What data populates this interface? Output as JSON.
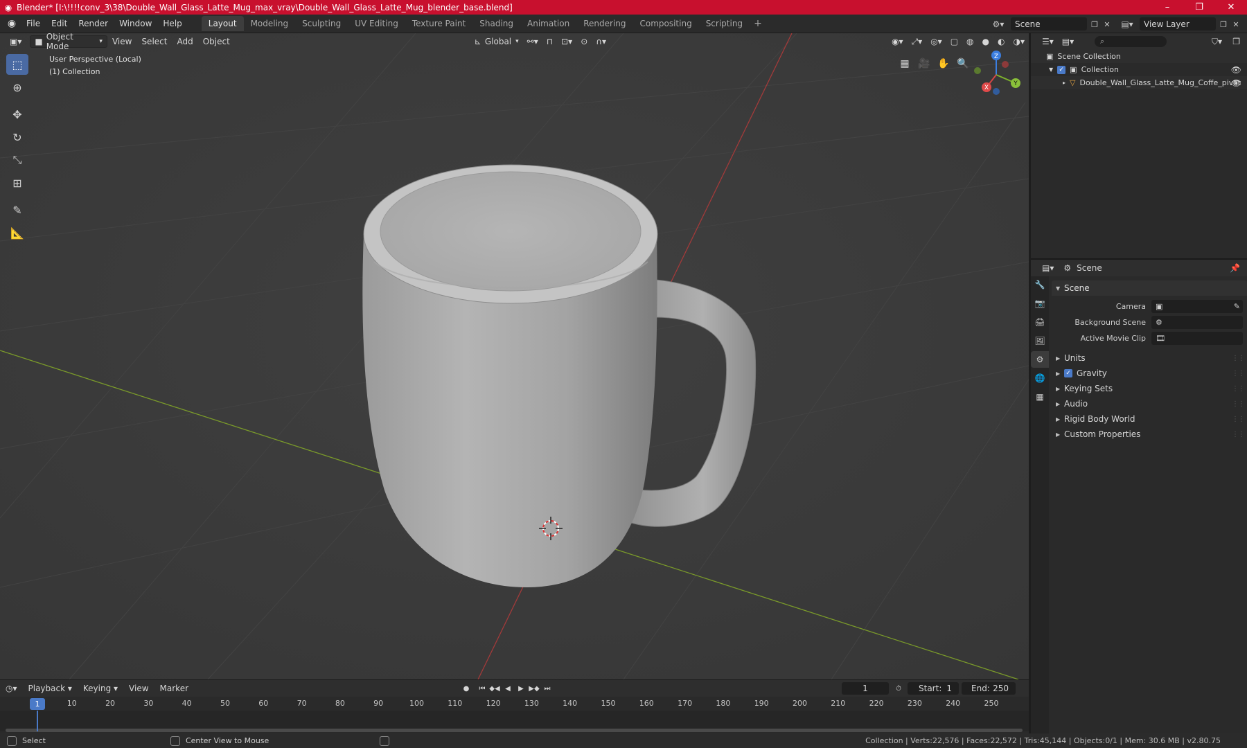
{
  "titlebar": {
    "title": "Blender* [I:\\!!!!conv_3\\38\\Double_Wall_Glass_Latte_Mug_max_vray\\Double_Wall_Glass_Latte_Mug_blender_base.blend]",
    "minimize": "–",
    "maximize": "❐",
    "close": "✕"
  },
  "menubar": {
    "menus": [
      "File",
      "Edit",
      "Render",
      "Window",
      "Help"
    ],
    "workspaces": [
      "Layout",
      "Modeling",
      "Sculpting",
      "UV Editing",
      "Texture Paint",
      "Shading",
      "Animation",
      "Rendering",
      "Compositing",
      "Scripting"
    ],
    "active_workspace": "Layout",
    "add_workspace": "+",
    "scene": "Scene",
    "view_layer": "View Layer"
  },
  "viewport": {
    "mode": "Object Mode",
    "menus": [
      "View",
      "Select",
      "Add",
      "Object"
    ],
    "orientation": "Global",
    "info_line1": "User Perspective (Local)",
    "info_line2": "(1) Collection",
    "gizmo": {
      "x": "X",
      "y": "Y",
      "z": "Z"
    }
  },
  "outliner": {
    "search_placeholder": "",
    "rows": [
      {
        "label": "Scene Collection"
      },
      {
        "label": "Collection"
      },
      {
        "label": "Double_Wall_Glass_Latte_Mug_Coffe_pivot"
      }
    ]
  },
  "properties": {
    "header": "Scene",
    "panel": "Scene",
    "fields": [
      {
        "label": "Camera",
        "value": ""
      },
      {
        "label": "Background Scene",
        "value": ""
      },
      {
        "label": "Active Movie Clip",
        "value": ""
      }
    ],
    "subpanels": [
      "Units",
      "Gravity",
      "Keying Sets",
      "Audio",
      "Rigid Body World",
      "Custom Properties"
    ],
    "gravity_checked": true
  },
  "timeline": {
    "menus": [
      "Playback",
      "Keying",
      "View",
      "Marker"
    ],
    "current_frame": "1",
    "start_label": "Start:",
    "start": "1",
    "end_label": "End:",
    "end": "250",
    "ticks": [
      "1",
      "10",
      "20",
      "30",
      "40",
      "50",
      "60",
      "70",
      "80",
      "90",
      "100",
      "110",
      "120",
      "130",
      "140",
      "150",
      "160",
      "170",
      "180",
      "190",
      "200",
      "210",
      "220",
      "230",
      "240",
      "250"
    ]
  },
  "statusbar": {
    "select": "Select",
    "center_view": "Center View to Mouse",
    "stats": "Collection | Verts:22,576 | Faces:22,572 | Tris:45,144 | Objects:0/1 | Mem: 30.6 MB | v2.80.75"
  }
}
